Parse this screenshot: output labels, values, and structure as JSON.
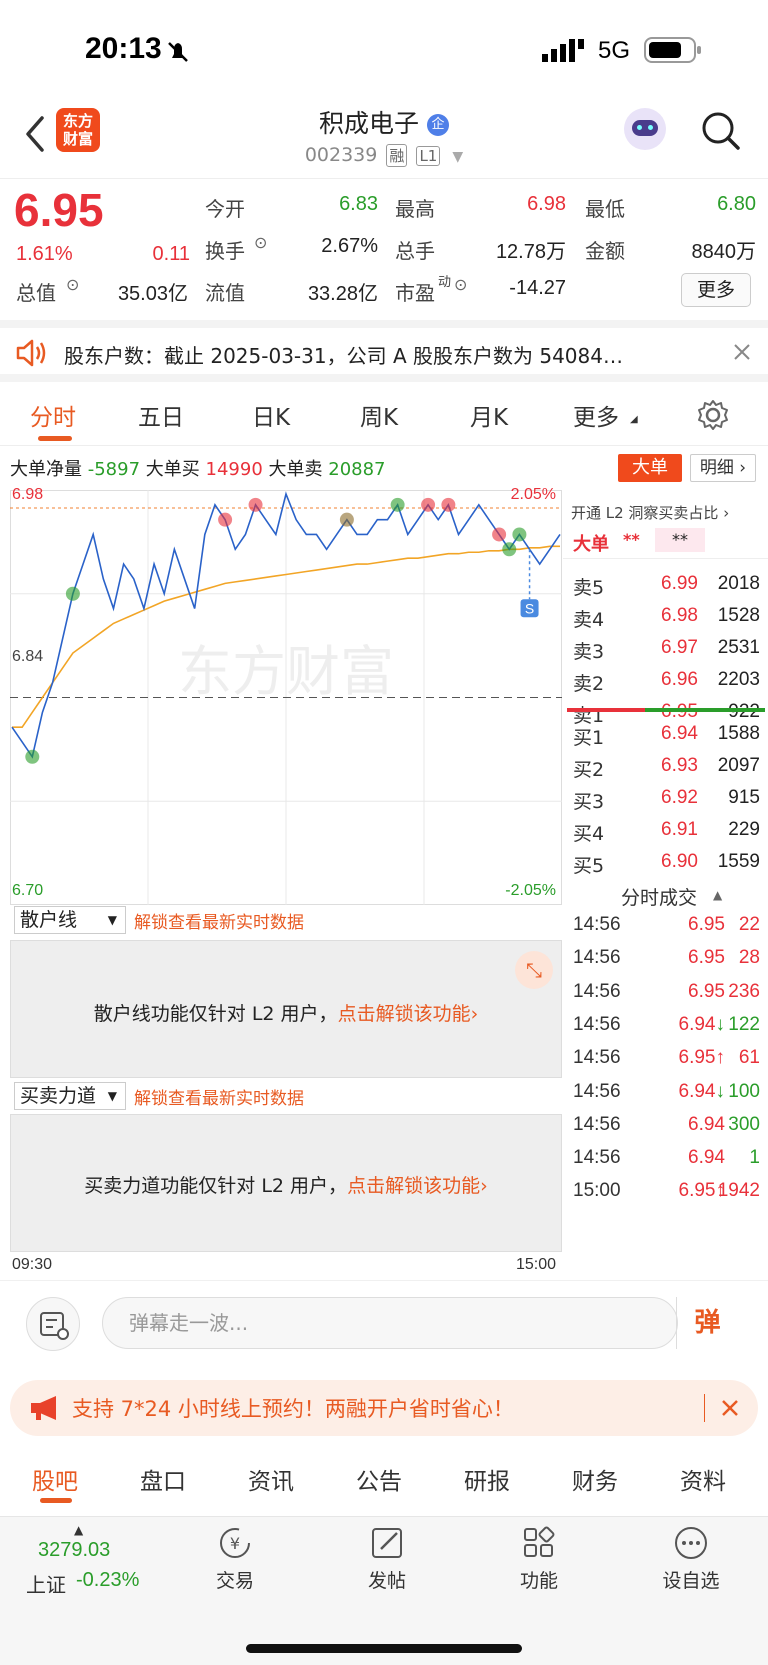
{
  "status_bar": {
    "time": "20:13",
    "network": "5G"
  },
  "header": {
    "logo_text": "东方\n财富",
    "stock_name": "积成电子",
    "stock_code": "002339",
    "tags": [
      "融",
      "L1"
    ]
  },
  "quote": {
    "price": "6.95",
    "change_pct": "1.61%",
    "change": "0.11",
    "fields": [
      {
        "label": "今开",
        "value": "6.83",
        "color": "green"
      },
      {
        "label": "最高",
        "value": "6.98",
        "color": "red"
      },
      {
        "label": "最低",
        "value": "6.80",
        "color": "green"
      },
      {
        "label": "换手",
        "value": "2.67%",
        "color": "normal"
      },
      {
        "label": "总手",
        "value": "12.78万",
        "color": "normal"
      },
      {
        "label": "金额",
        "value": "8840万",
        "color": "normal"
      },
      {
        "label": "总值",
        "value": "35.03亿",
        "color": "normal"
      },
      {
        "label": "流值",
        "value": "33.28亿",
        "color": "normal"
      },
      {
        "label": "市盈",
        "value": "-14.27",
        "color": "normal"
      }
    ],
    "pe_sup": "动",
    "more_label": "更多"
  },
  "notice": {
    "text": "股东户数：截止 2025-03-31，公司 A 股股东户数为 54084…"
  },
  "tabs": [
    "分时",
    "五日",
    "日K",
    "周K",
    "月K",
    "更多"
  ],
  "big_order": {
    "net_label": "大单净量",
    "net_value": "-5897",
    "buy_label": "大单买",
    "buy_value": "14990",
    "sell_label": "大单卖",
    "sell_value": "20887",
    "btn_big": "大单",
    "btn_detail": "明细"
  },
  "chart_data": {
    "type": "line",
    "x_start": "09:30",
    "x_end": "15:00",
    "ylim": [
      6.7,
      6.98
    ],
    "y_top_label": "6.98",
    "y_mid_label": "6.84",
    "y_bottom_label": "6.70",
    "pct_top_label": "2.05%",
    "pct_bottom_label": "-2.05%",
    "watermark": "东方财富",
    "marker_s": "S",
    "price_series": [
      6.82,
      6.81,
      6.8,
      6.83,
      6.85,
      6.88,
      6.91,
      6.93,
      6.95,
      6.92,
      6.9,
      6.93,
      6.92,
      6.9,
      6.93,
      6.91,
      6.94,
      6.92,
      6.9,
      6.95,
      6.97,
      6.96,
      6.94,
      6.95,
      6.97,
      6.96,
      6.95,
      6.98,
      6.96,
      6.95,
      6.95,
      6.94,
      6.95,
      6.96,
      6.95,
      6.95,
      6.96,
      6.96,
      6.97,
      6.95,
      6.96,
      6.97,
      6.96,
      6.97,
      6.95,
      6.96,
      6.97,
      6.96,
      6.95,
      6.94,
      6.95,
      6.94,
      6.93,
      6.94,
      6.95
    ],
    "avg_series": [
      6.82,
      6.82,
      6.83,
      6.84,
      6.85,
      6.86,
      6.87,
      6.875,
      6.88,
      6.885,
      6.89,
      6.893,
      6.896,
      6.899,
      6.902,
      6.905,
      6.907,
      6.909,
      6.911,
      6.913,
      6.915,
      6.917,
      6.918,
      6.919,
      6.92,
      6.921,
      6.922,
      6.923,
      6.924,
      6.925,
      6.926,
      6.927,
      6.928,
      6.929,
      6.93,
      6.93,
      6.931,
      6.932,
      6.933,
      6.934,
      6.934,
      6.935,
      6.936,
      6.937,
      6.937,
      6.938,
      6.938,
      6.939,
      6.939,
      6.94,
      6.94,
      6.941,
      6.941,
      6.942,
      6.942
    ]
  },
  "order_book": {
    "header": "开通 L2 洞察买卖占比",
    "big_label": "大单",
    "big_masked": "**",
    "big_masked2": "**",
    "asks": [
      {
        "label": "卖5",
        "price": "6.99",
        "vol": "2018"
      },
      {
        "label": "卖4",
        "price": "6.98",
        "vol": "1528"
      },
      {
        "label": "卖3",
        "price": "6.97",
        "vol": "2531"
      },
      {
        "label": "卖2",
        "price": "6.96",
        "vol": "2203"
      },
      {
        "label": "卖1",
        "price": "6.95",
        "vol": "922"
      }
    ],
    "bids": [
      {
        "label": "买1",
        "price": "6.94",
        "vol": "1588"
      },
      {
        "label": "买2",
        "price": "6.93",
        "vol": "2097"
      },
      {
        "label": "买3",
        "price": "6.92",
        "vol": "915"
      },
      {
        "label": "买4",
        "price": "6.91",
        "vol": "229"
      },
      {
        "label": "买5",
        "price": "6.90",
        "vol": "1559"
      }
    ],
    "trades_header": "分时成交",
    "trades": [
      {
        "time": "14:56",
        "price": "6.95",
        "arrow": "",
        "vol": "22",
        "vcolor": "red"
      },
      {
        "time": "14:56",
        "price": "6.95",
        "arrow": "",
        "vol": "28",
        "vcolor": "red"
      },
      {
        "time": "14:56",
        "price": "6.95",
        "arrow": "",
        "vol": "236",
        "vcolor": "red"
      },
      {
        "time": "14:56",
        "price": "6.94",
        "arrow": "↓",
        "vol": "122",
        "vcolor": "green"
      },
      {
        "time": "14:56",
        "price": "6.95",
        "arrow": "↑",
        "vol": "61",
        "vcolor": "red"
      },
      {
        "time": "14:56",
        "price": "6.94",
        "arrow": "↓",
        "vol": "100",
        "vcolor": "green"
      },
      {
        "time": "14:56",
        "price": "6.94",
        "arrow": "",
        "vol": "300",
        "vcolor": "green"
      },
      {
        "time": "14:56",
        "price": "6.94",
        "arrow": "",
        "vol": "1",
        "vcolor": "green"
      },
      {
        "time": "15:00",
        "price": "6.95",
        "arrow": "↑",
        "vol": "1942",
        "vcolor": "red"
      }
    ]
  },
  "panels": {
    "retail": {
      "select": "散户线",
      "link": "解锁查看最新实时数据",
      "text": "散户线功能仅针对 L2 用户，",
      "unlock": "点击解锁该功能"
    },
    "force": {
      "select": "买卖力道",
      "link": "解锁查看最新实时数据",
      "text": "买卖力道功能仅针对 L2 用户，",
      "unlock": "点击解锁该功能"
    }
  },
  "comment": {
    "placeholder": "弹幕走一波...",
    "danmu_btn": "弹"
  },
  "promo": {
    "text": "支持 7*24 小时线上预约！两融开户省时省心！"
  },
  "bottom_tabs": [
    "股吧",
    "盘口",
    "资讯",
    "公告",
    "研报",
    "财务",
    "资料"
  ],
  "dock": {
    "index_value": "3279.03",
    "index_name": "上证",
    "index_change": "-0.23%",
    "items": [
      "交易",
      "发帖",
      "功能",
      "设自选"
    ]
  },
  "colors": {
    "accent": "#e85a22",
    "up": "#e8313a",
    "down": "#2a9d2a",
    "price_line": "#2a62c9",
    "avg_line": "#f2a526"
  }
}
